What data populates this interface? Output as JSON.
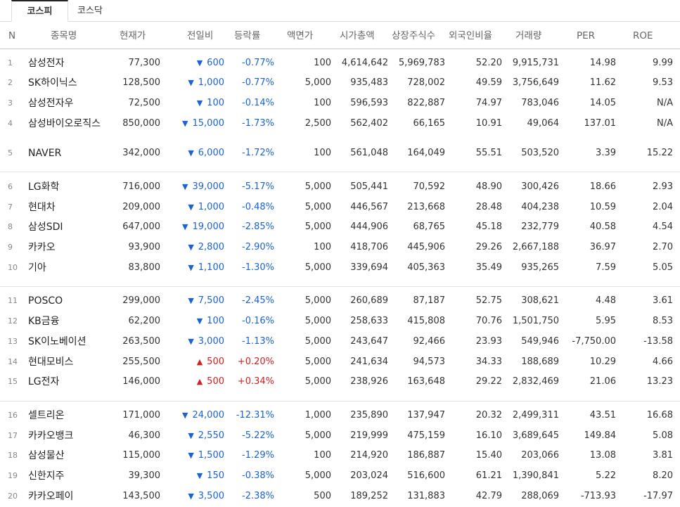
{
  "tabs": [
    {
      "label": "코스피"
    },
    {
      "label": "코스닥"
    }
  ],
  "headers": [
    "N",
    "종목명",
    "현재가",
    "전일비",
    "등락률",
    "액면가",
    "시가총액",
    "상장주식수",
    "외국인비율",
    "거래량",
    "PER",
    "ROE"
  ],
  "rows": [
    {
      "n": "1",
      "name": "삼성전자",
      "price": "77,300",
      "dir": "down",
      "change": "600",
      "rate": "-0.77%",
      "face": "100",
      "cap": "4,614,642",
      "shares": "5,969,783",
      "foreign": "52.20",
      "volume": "9,915,731",
      "per": "14.98",
      "roe": "9.99"
    },
    {
      "n": "2",
      "name": "SK하이닉스",
      "price": "128,500",
      "dir": "down",
      "change": "1,000",
      "rate": "-0.77%",
      "face": "5,000",
      "cap": "935,483",
      "shares": "728,002",
      "foreign": "49.59",
      "volume": "3,756,649",
      "per": "11.62",
      "roe": "9.53"
    },
    {
      "n": "3",
      "name": "삼성전자우",
      "price": "72,500",
      "dir": "down",
      "change": "100",
      "rate": "-0.14%",
      "face": "100",
      "cap": "596,593",
      "shares": "822,887",
      "foreign": "74.97",
      "volume": "783,046",
      "per": "14.05",
      "roe": "N/A"
    },
    {
      "n": "4",
      "name": "삼성바이오로직스",
      "price": "850,000",
      "dir": "down",
      "change": "15,000",
      "rate": "-1.73%",
      "face": "2,500",
      "cap": "562,402",
      "shares": "66,165",
      "foreign": "10.91",
      "volume": "49,064",
      "per": "137.01",
      "roe": "N/A"
    },
    {
      "n": "5",
      "name": "NAVER",
      "price": "342,000",
      "dir": "down",
      "change": "6,000",
      "rate": "-1.72%",
      "face": "100",
      "cap": "561,048",
      "shares": "164,049",
      "foreign": "55.51",
      "volume": "503,520",
      "per": "3.39",
      "roe": "15.22"
    },
    {
      "n": "6",
      "name": "LG화학",
      "price": "716,000",
      "dir": "down",
      "change": "39,000",
      "rate": "-5.17%",
      "face": "5,000",
      "cap": "505,441",
      "shares": "70,592",
      "foreign": "48.90",
      "volume": "300,426",
      "per": "18.66",
      "roe": "2.93"
    },
    {
      "n": "7",
      "name": "현대차",
      "price": "209,000",
      "dir": "down",
      "change": "1,000",
      "rate": "-0.48%",
      "face": "5,000",
      "cap": "446,567",
      "shares": "213,668",
      "foreign": "28.48",
      "volume": "404,238",
      "per": "10.59",
      "roe": "2.04"
    },
    {
      "n": "8",
      "name": "삼성SDI",
      "price": "647,000",
      "dir": "down",
      "change": "19,000",
      "rate": "-2.85%",
      "face": "5,000",
      "cap": "444,906",
      "shares": "68,765",
      "foreign": "45.18",
      "volume": "232,779",
      "per": "40.58",
      "roe": "4.54"
    },
    {
      "n": "9",
      "name": "카카오",
      "price": "93,900",
      "dir": "down",
      "change": "2,800",
      "rate": "-2.90%",
      "face": "100",
      "cap": "418,706",
      "shares": "445,906",
      "foreign": "29.26",
      "volume": "2,667,188",
      "per": "36.97",
      "roe": "2.70"
    },
    {
      "n": "10",
      "name": "기아",
      "price": "83,800",
      "dir": "down",
      "change": "1,100",
      "rate": "-1.30%",
      "face": "5,000",
      "cap": "339,694",
      "shares": "405,363",
      "foreign": "35.49",
      "volume": "935,265",
      "per": "7.59",
      "roe": "5.05"
    },
    {
      "n": "11",
      "name": "POSCO",
      "price": "299,000",
      "dir": "down",
      "change": "7,500",
      "rate": "-2.45%",
      "face": "5,000",
      "cap": "260,689",
      "shares": "87,187",
      "foreign": "52.75",
      "volume": "308,621",
      "per": "4.48",
      "roe": "3.61"
    },
    {
      "n": "12",
      "name": "KB금융",
      "price": "62,200",
      "dir": "down",
      "change": "100",
      "rate": "-0.16%",
      "face": "5,000",
      "cap": "258,633",
      "shares": "415,808",
      "foreign": "70.76",
      "volume": "1,501,750",
      "per": "5.95",
      "roe": "8.53"
    },
    {
      "n": "13",
      "name": "SK이노베이션",
      "price": "263,500",
      "dir": "down",
      "change": "3,000",
      "rate": "-1.13%",
      "face": "5,000",
      "cap": "243,647",
      "shares": "92,466",
      "foreign": "23.93",
      "volume": "549,946",
      "per": "-7,750.00",
      "roe": "-13.58"
    },
    {
      "n": "14",
      "name": "현대모비스",
      "price": "255,500",
      "dir": "up",
      "change": "500",
      "rate": "+0.20%",
      "face": "5,000",
      "cap": "241,634",
      "shares": "94,573",
      "foreign": "34.33",
      "volume": "188,689",
      "per": "10.29",
      "roe": "4.66"
    },
    {
      "n": "15",
      "name": "LG전자",
      "price": "146,000",
      "dir": "up",
      "change": "500",
      "rate": "+0.34%",
      "face": "5,000",
      "cap": "238,926",
      "shares": "163,648",
      "foreign": "29.22",
      "volume": "2,832,469",
      "per": "21.06",
      "roe": "13.23"
    },
    {
      "n": "16",
      "name": "셀트리온",
      "price": "171,000",
      "dir": "down",
      "change": "24,000",
      "rate": "-12.31%",
      "face": "1,000",
      "cap": "235,890",
      "shares": "137,947",
      "foreign": "20.32",
      "volume": "2,499,311",
      "per": "43.51",
      "roe": "16.68"
    },
    {
      "n": "17",
      "name": "카카오뱅크",
      "price": "46,300",
      "dir": "down",
      "change": "2,550",
      "rate": "-5.22%",
      "face": "5,000",
      "cap": "219,999",
      "shares": "475,159",
      "foreign": "16.10",
      "volume": "3,689,645",
      "per": "149.84",
      "roe": "5.08"
    },
    {
      "n": "18",
      "name": "삼성물산",
      "price": "115,000",
      "dir": "down",
      "change": "1,500",
      "rate": "-1.29%",
      "face": "100",
      "cap": "214,920",
      "shares": "186,887",
      "foreign": "15.40",
      "volume": "203,066",
      "per": "13.08",
      "roe": "3.81"
    },
    {
      "n": "19",
      "name": "신한지주",
      "price": "39,300",
      "dir": "down",
      "change": "150",
      "rate": "-0.38%",
      "face": "5,000",
      "cap": "203,024",
      "shares": "516,600",
      "foreign": "61.21",
      "volume": "1,390,841",
      "per": "5.22",
      "roe": "8.20"
    },
    {
      "n": "20",
      "name": "카카오페이",
      "price": "143,500",
      "dir": "down",
      "change": "3,500",
      "rate": "-2.38%",
      "face": "500",
      "cap": "189,252",
      "shares": "131,883",
      "foreign": "42.79",
      "volume": "288,069",
      "per": "-713.93",
      "roe": "-17.97"
    }
  ],
  "colors": {
    "down": "#1a62d8",
    "up": "#d31f1f"
  },
  "icons": {
    "down": "triangle-down-icon",
    "up": "triangle-up-icon"
  }
}
